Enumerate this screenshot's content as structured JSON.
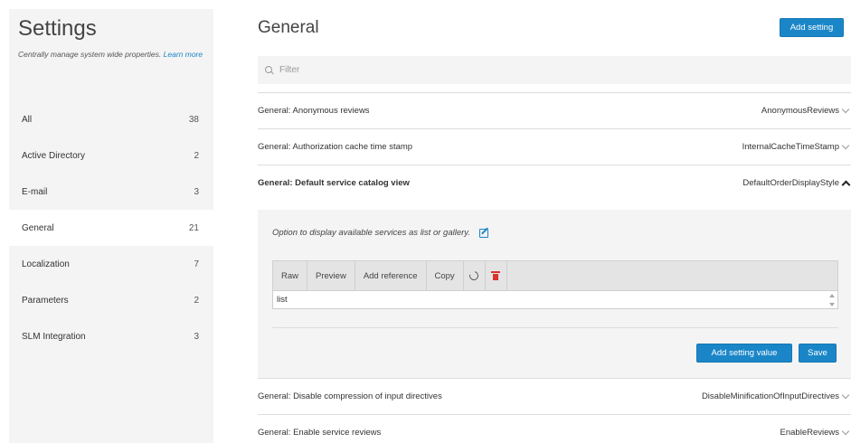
{
  "sidebar": {
    "title": "Settings",
    "description": "Centrally manage system wide properties.",
    "learn_more": "Learn more",
    "items": [
      {
        "label": "All",
        "count": "38"
      },
      {
        "label": "Active Directory",
        "count": "2"
      },
      {
        "label": "E-mail",
        "count": "3"
      },
      {
        "label": "General",
        "count": "21"
      },
      {
        "label": "Localization",
        "count": "7"
      },
      {
        "label": "Parameters",
        "count": "2"
      },
      {
        "label": "SLM Integration",
        "count": "3"
      }
    ],
    "active_index": 3
  },
  "header": {
    "title": "General",
    "add_setting_label": "Add setting"
  },
  "filter": {
    "placeholder": "Filter",
    "value": ""
  },
  "settings": [
    {
      "name": "General: Anonymous reviews",
      "key": "AnonymousReviews",
      "expanded": false
    },
    {
      "name": "General: Authorization cache time stamp",
      "key": "InternalCacheTimeStamp",
      "expanded": false
    },
    {
      "name": "General: Default service catalog view",
      "key": "DefaultOrderDisplayStyle",
      "expanded": true
    },
    {
      "name": "General: Disable compression of input directives",
      "key": "DisableMinificationOfInputDirectives",
      "expanded": false
    },
    {
      "name": "General: Enable service reviews",
      "key": "EnableReviews",
      "expanded": false
    }
  ],
  "expanded_panel": {
    "description": "Option to display available services as list or gallery.",
    "toolbar": {
      "raw": "Raw",
      "preview": "Preview",
      "add_reference": "Add reference",
      "copy": "Copy"
    },
    "value": "list",
    "add_value_label": "Add setting value",
    "save_label": "Save"
  },
  "colors": {
    "accent": "#1a86c8",
    "sidebar_bg": "#f4f4f4",
    "delete": "#d9342b"
  },
  "icons": [
    "search-icon",
    "chevron-down-icon",
    "chevron-up-icon",
    "edit-icon",
    "refresh-icon",
    "trash-icon"
  ]
}
